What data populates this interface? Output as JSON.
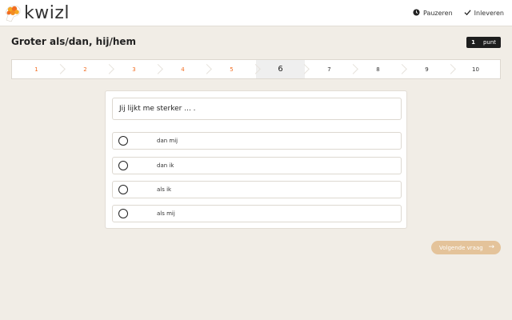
{
  "app": {
    "brand": "kwizl",
    "brand_color": "#f26d21",
    "logo_icon": "brain-icon"
  },
  "topbar": {
    "pause_label": "Pauzeren",
    "pause_icon": "clock-icon",
    "submit_label": "Inleveren",
    "submit_icon": "check-icon"
  },
  "quiz": {
    "title": "Groter als/dan, hij/hem",
    "points_value": "1",
    "points_label": "punt",
    "steps": [
      "1",
      "2",
      "3",
      "4",
      "5",
      "6",
      "7",
      "8",
      "9",
      "10"
    ],
    "current_step": 6,
    "question": "Jij lijkt me sterker ... .",
    "options": [
      "dan mij",
      "dan ik",
      "als ik",
      "als mij"
    ],
    "next_label": "Volgende vraag",
    "next_icon": "arrow-right-icon",
    "next_color": "#e4c39a"
  }
}
